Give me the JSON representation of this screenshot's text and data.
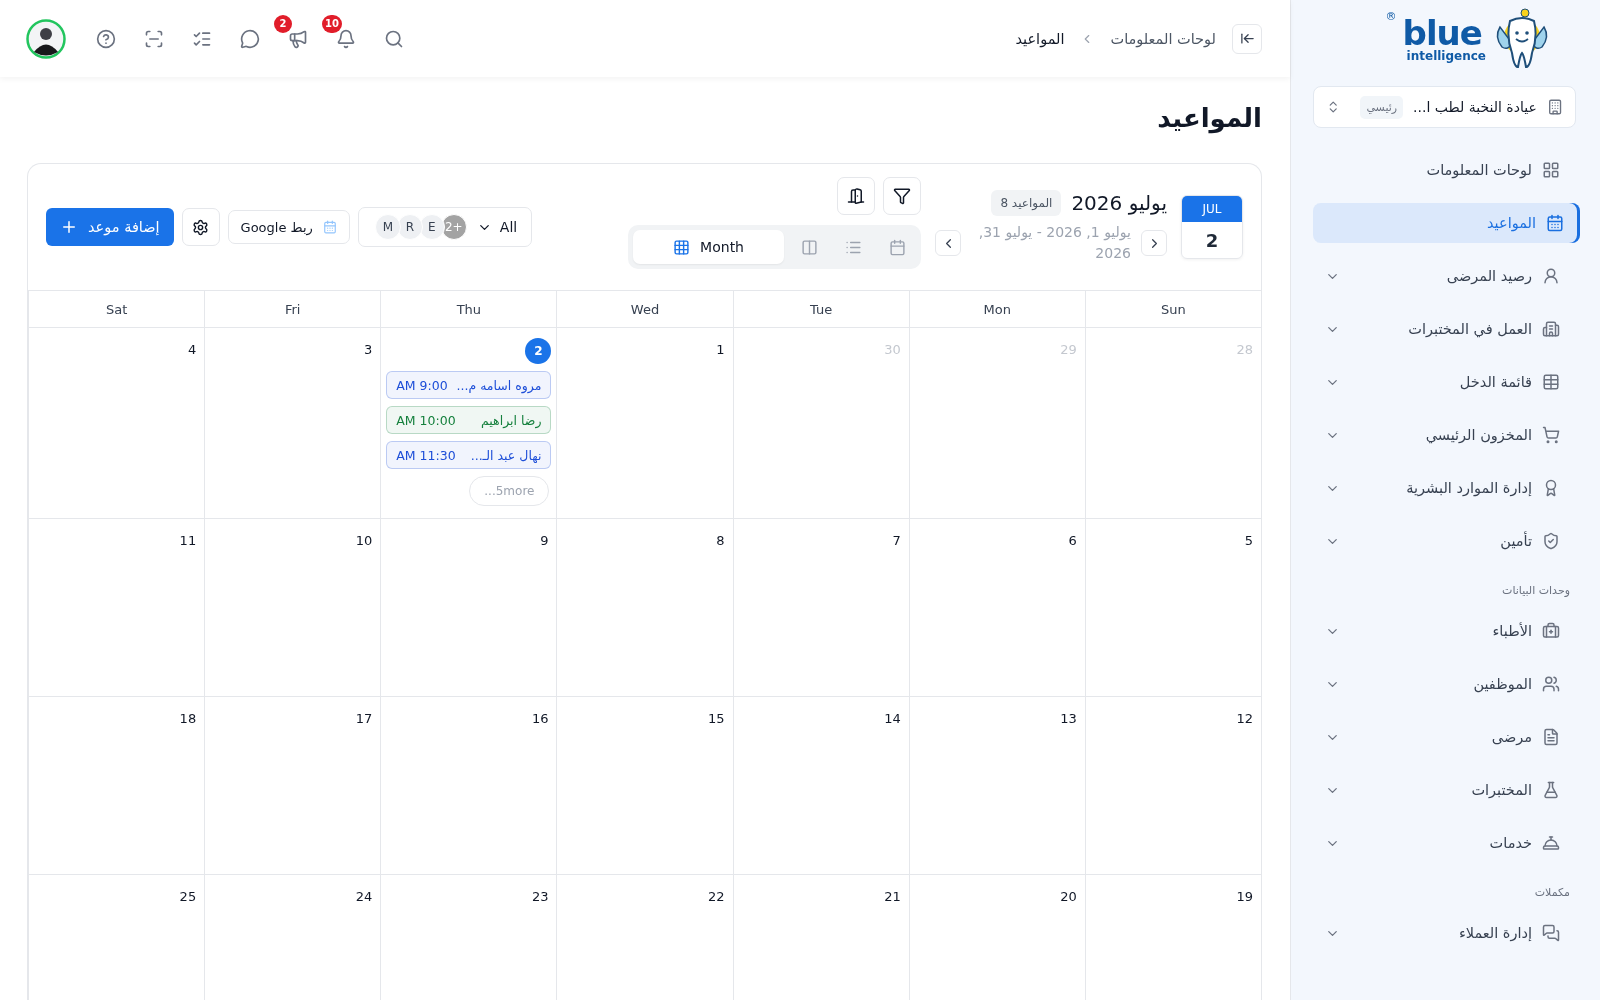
{
  "brand": {
    "name": "blue",
    "tagline": "intelligence",
    "mark": "®"
  },
  "clinic": {
    "name": "عيادة النخبة لطب ا...",
    "tag": "رئيسي"
  },
  "sidebar": {
    "sections": [
      {
        "items": [
          {
            "label": "لوحات المعلومات",
            "selected": false,
            "expandable": false
          },
          {
            "label": "المواعيد",
            "selected": true,
            "expandable": false
          },
          {
            "label": "رصيد المرضى",
            "selected": false,
            "expandable": true
          },
          {
            "label": "العمل في المختبرات",
            "selected": false,
            "expandable": true
          },
          {
            "label": "قائمة الدخل",
            "selected": false,
            "expandable": true
          },
          {
            "label": "المخزون الرئيسي",
            "selected": false,
            "expandable": true
          },
          {
            "label": "إدارة الموارد البشرية",
            "selected": false,
            "expandable": true
          },
          {
            "label": "تأمين",
            "selected": false,
            "expandable": true
          }
        ]
      },
      {
        "title": "وحدات البيانات",
        "items": [
          {
            "label": "الأطباء",
            "selected": false,
            "expandable": true
          },
          {
            "label": "الموظفين",
            "selected": false,
            "expandable": true
          },
          {
            "label": "مرضى",
            "selected": false,
            "expandable": true
          },
          {
            "label": "المختبرات",
            "selected": false,
            "expandable": true
          },
          {
            "label": "خدمات",
            "selected": false,
            "expandable": true
          }
        ]
      },
      {
        "title": "مكملات",
        "items": [
          {
            "label": "إدارة العملاء",
            "selected": false,
            "expandable": true
          }
        ]
      }
    ]
  },
  "topbar": {
    "breadcrumb": [
      "لوحات المعلومات",
      "المواعيد"
    ],
    "announcements_badge": "2",
    "notifications_badge": "10"
  },
  "page": {
    "title": "المواعيد"
  },
  "calendar": {
    "today_month": "JUL",
    "today_day": "2",
    "title": "يوليو 2026",
    "count": "المواعيد 8",
    "range": "يوليو 1, 2026 - يوليو 31, 2026",
    "views": [
      {
        "kind": "calendar",
        "selected": false
      },
      {
        "kind": "list",
        "selected": false
      },
      {
        "kind": "columns",
        "selected": false
      },
      {
        "kind": "month",
        "label": "Month",
        "selected": true
      }
    ],
    "members": [
      "E",
      "R",
      "M"
    ],
    "members_more": "+2",
    "member_filter": "All",
    "google": "ربط Google",
    "add": "إضافة موعد",
    "weekdays": [
      "Sun",
      "Mon",
      "Tue",
      "Wed",
      "Thu",
      "Fri",
      "Sat"
    ],
    "weeks": [
      [
        {
          "day": "28",
          "muted": true
        },
        {
          "day": "29",
          "muted": true
        },
        {
          "day": "30",
          "muted": true
        },
        {
          "day": "1"
        },
        {
          "day": "2",
          "today": true,
          "events": [
            {
              "name": "مروه اسامه م...",
              "time": "AM 9:00",
              "color": "#1d4ed8"
            },
            {
              "name": "رضا ابراهيم",
              "time": "AM 10:00",
              "color": "#15803d"
            },
            {
              "name": "نهال عبد الـ...",
              "time": "AM 11:30",
              "color": "#1d4ed8"
            }
          ],
          "more": "...5more"
        },
        {
          "day": "3"
        },
        {
          "day": "4"
        }
      ],
      [
        {
          "day": "5"
        },
        {
          "day": "6"
        },
        {
          "day": "7"
        },
        {
          "day": "8"
        },
        {
          "day": "9"
        },
        {
          "day": "10"
        },
        {
          "day": "11"
        }
      ],
      [
        {
          "day": "12"
        },
        {
          "day": "13"
        },
        {
          "day": "14"
        },
        {
          "day": "15"
        },
        {
          "day": "16"
        },
        {
          "day": "17"
        },
        {
          "day": "18"
        }
      ],
      [
        {
          "day": "19"
        },
        {
          "day": "20"
        },
        {
          "day": "21"
        },
        {
          "day": "22"
        },
        {
          "day": "23"
        },
        {
          "day": "24"
        },
        {
          "day": "25"
        }
      ]
    ]
  }
}
